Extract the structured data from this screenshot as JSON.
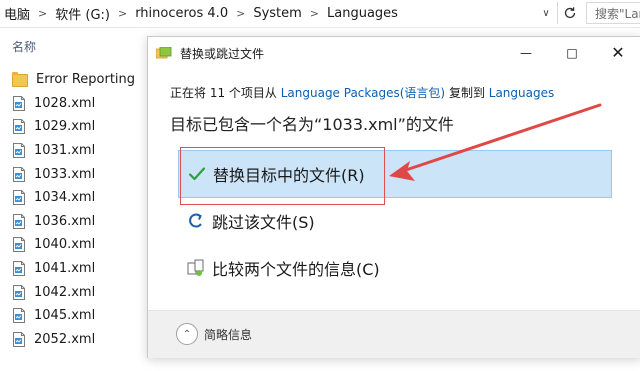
{
  "address_bar": {
    "crumbs": [
      "电脑",
      "软件 (G:)",
      "rhinoceros 4.0",
      "System",
      "Languages"
    ],
    "search_placeholder": "搜索\"Lan"
  },
  "explorer": {
    "column_header": "名称",
    "items": [
      {
        "name": "Error Reporting",
        "type": "folder"
      },
      {
        "name": "1028.xml",
        "type": "xml"
      },
      {
        "name": "1029.xml",
        "type": "xml"
      },
      {
        "name": "1031.xml",
        "type": "xml"
      },
      {
        "name": "1033.xml",
        "type": "xml"
      },
      {
        "name": "1034.xml",
        "type": "xml"
      },
      {
        "name": "1036.xml",
        "type": "xml"
      },
      {
        "name": "1040.xml",
        "type": "xml"
      },
      {
        "name": "1041.xml",
        "type": "xml"
      },
      {
        "name": "1042.xml",
        "type": "xml"
      },
      {
        "name": "1045.xml",
        "type": "xml"
      },
      {
        "name": "2052.xml",
        "type": "xml"
      }
    ]
  },
  "dialog": {
    "title": "替换或跳过文件",
    "copy_info": {
      "prefix": "正在将 11 个项目从 ",
      "source": "Language Packages(语言包)",
      "middle": " 复制到 ",
      "destination": "Languages"
    },
    "headline": "目标已包含一个名为“1033.xml”的文件",
    "options": {
      "replace": "替换目标中的文件(R)",
      "skip": "跳过该文件(S)",
      "compare": "比较两个文件的信息(C)"
    },
    "details_label": "简略信息",
    "colors": {
      "check": "#2e9e3e",
      "annotation": "#e04848",
      "link": "#0a5fb4",
      "highlight": "#cce4f7"
    }
  }
}
